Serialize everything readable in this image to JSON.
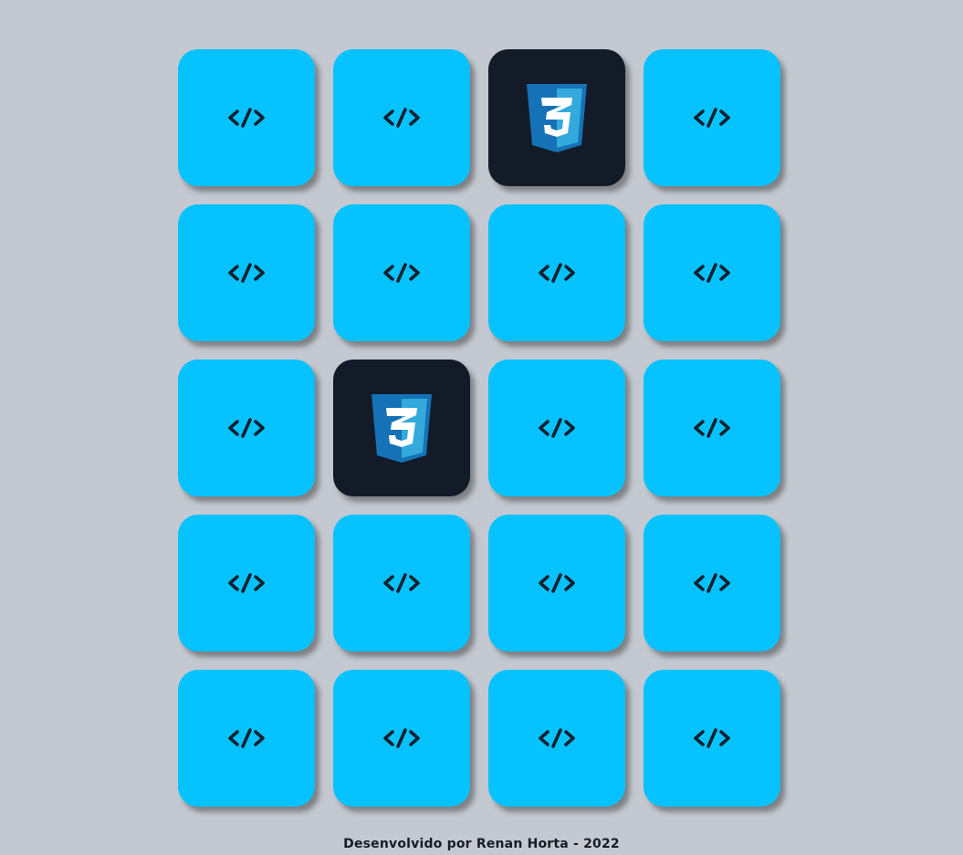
{
  "board": {
    "columns": 4,
    "cards": [
      {
        "state": "hidden",
        "icon": "code-icon"
      },
      {
        "state": "hidden",
        "icon": "code-icon"
      },
      {
        "state": "revealed",
        "icon": "css3-logo-icon"
      },
      {
        "state": "hidden",
        "icon": "code-icon"
      },
      {
        "state": "hidden",
        "icon": "code-icon"
      },
      {
        "state": "hidden",
        "icon": "code-icon"
      },
      {
        "state": "hidden",
        "icon": "code-icon"
      },
      {
        "state": "hidden",
        "icon": "code-icon"
      },
      {
        "state": "hidden",
        "icon": "code-icon"
      },
      {
        "state": "revealed",
        "icon": "css3-logo-icon"
      },
      {
        "state": "hidden",
        "icon": "code-icon"
      },
      {
        "state": "hidden",
        "icon": "code-icon"
      },
      {
        "state": "hidden",
        "icon": "code-icon"
      },
      {
        "state": "hidden",
        "icon": "code-icon"
      },
      {
        "state": "hidden",
        "icon": "code-icon"
      },
      {
        "state": "hidden",
        "icon": "code-icon"
      },
      {
        "state": "hidden",
        "icon": "code-icon"
      },
      {
        "state": "hidden",
        "icon": "code-icon"
      },
      {
        "state": "hidden",
        "icon": "code-icon"
      },
      {
        "state": "hidden",
        "icon": "code-icon"
      }
    ]
  },
  "footer": {
    "credit": "Desenvolvido por Renan Horta - 2022"
  },
  "colors": {
    "background": "#c4c9d1",
    "card_back": "#06c2fe",
    "card_front": "#131b28",
    "code_icon": "#13202e",
    "css_shield_dark": "#1572b6",
    "css_shield_light": "#33a9dc"
  }
}
